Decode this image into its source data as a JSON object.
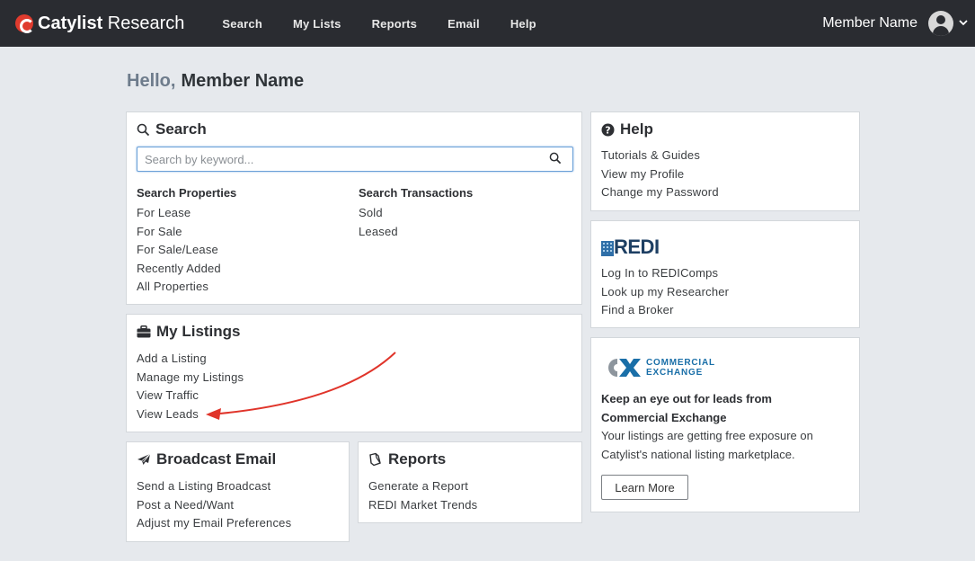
{
  "navbar": {
    "brand_bold": "Catylist",
    "brand_rest": " Research",
    "links": [
      "Search",
      "My Lists",
      "Reports",
      "Email",
      "Help"
    ],
    "member_name": "Member Name",
    "bg_color": "#2a2c31",
    "brand_color": "#e03b2e"
  },
  "greeting": {
    "hello": "Hello,",
    "name": "Member Name"
  },
  "search_card": {
    "title": "Search",
    "placeholder": "Search by keyword...",
    "properties_heading": "Search Properties",
    "properties_links": [
      "For Lease",
      "For Sale",
      "For Sale/Lease",
      "Recently Added",
      "All Properties"
    ],
    "transactions_heading": "Search Transactions",
    "transactions_links": [
      "Sold",
      "Leased"
    ]
  },
  "listings_card": {
    "title": "My Listings",
    "links": [
      "Add a Listing",
      "Manage my Listings",
      "View Traffic",
      "View Leads"
    ]
  },
  "broadcast_card": {
    "title": "Broadcast Email",
    "links": [
      "Send a Listing Broadcast",
      "Post a Need/Want",
      "Adjust my Email Preferences"
    ]
  },
  "reports_card": {
    "title": "Reports",
    "links": [
      "Generate a Report",
      "REDI Market Trends"
    ]
  },
  "help_card": {
    "title": "Help",
    "links": [
      "Tutorials & Guides",
      "View my Profile",
      "Change my Password"
    ]
  },
  "redi_card": {
    "logo_text": "REDI",
    "links": [
      "Log In to REDIComps",
      "Look up my Researcher",
      "Find a Broker"
    ]
  },
  "cx_card": {
    "logo_line1": "COMMERCIAL",
    "logo_line2": "EXCHANGE",
    "headline_line1": "Keep an eye out for leads from",
    "headline_line2": "Commercial Exchange",
    "body_line1": "Your listings are getting free exposure on",
    "body_line2": "Catylist's national listing marketplace.",
    "button_label": "Learn More"
  },
  "annotation": {
    "arrow_color": "#e0342a"
  }
}
